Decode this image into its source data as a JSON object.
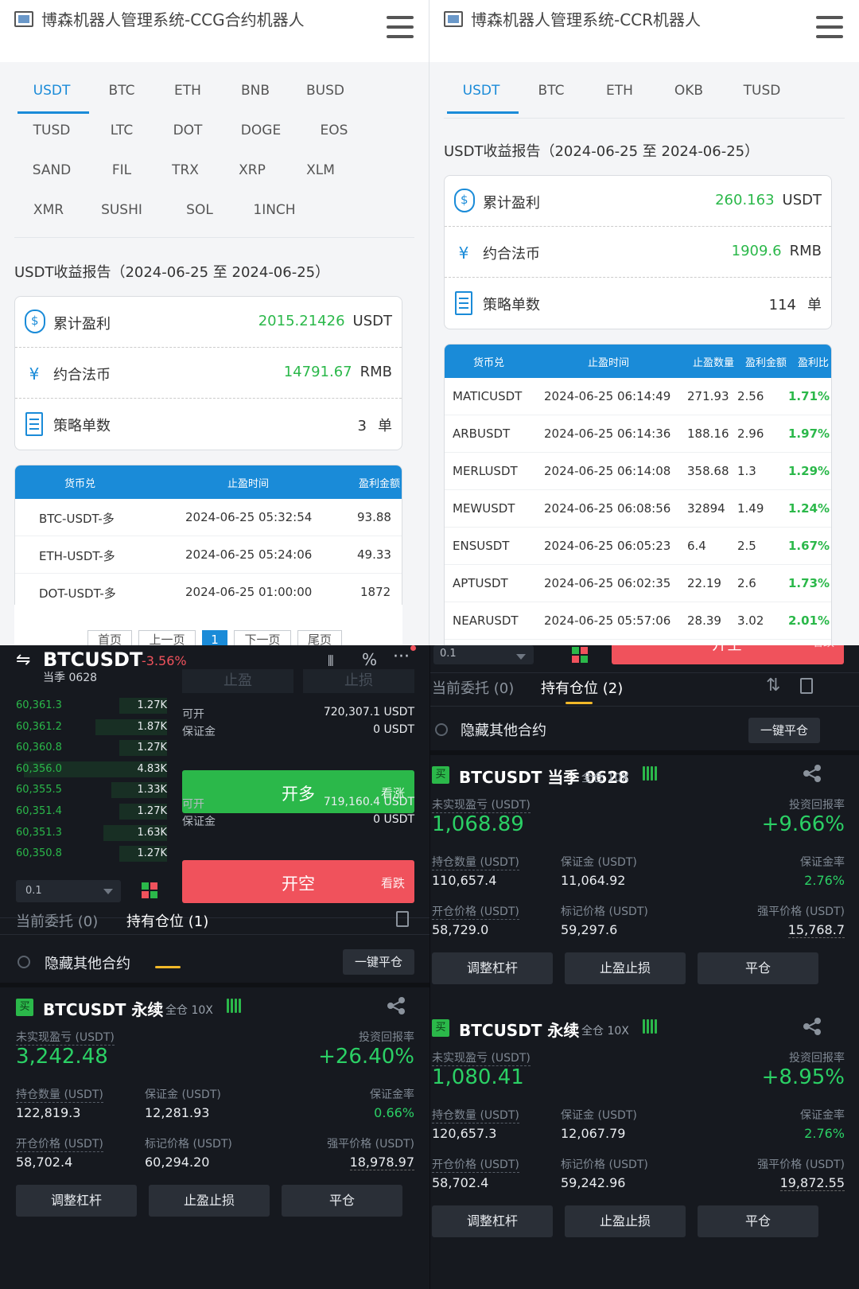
{
  "left_panel": {
    "title": "博森机器人管理系统-CCG合约机器人",
    "tabs": [
      "USDT",
      "BTC",
      "ETH",
      "BNB",
      "BUSD",
      "TUSD",
      "LTC",
      "DOT",
      "DOGE",
      "EOS",
      "SAND",
      "FIL",
      "TRX",
      "XRP",
      "XLM",
      "XMR",
      "SUSHI",
      "SOL",
      "1INCH"
    ],
    "active_tab": "USDT",
    "report_title": "USDT收益报告（2024-06-25 至 2024-06-25）",
    "summary": {
      "profit_label": "累计盈利",
      "profit_value": "2015.21426",
      "profit_unit": "USDT",
      "fiat_label": "约合法币",
      "fiat_value": "14791.67",
      "fiat_unit": "RMB",
      "orders_label": "策略单数",
      "orders_value": "3",
      "orders_unit": "单"
    },
    "table": {
      "headers": [
        "货币兑",
        "止盈时间",
        "盈利金额"
      ],
      "rows": [
        [
          "BTC-USDT-多",
          "2024-06-25 05:32:54",
          "93.88"
        ],
        [
          "ETH-USDT-多",
          "2024-06-25 05:24:06",
          "49.33"
        ],
        [
          "DOT-USDT-多",
          "2024-06-25 01:00:00",
          "1872"
        ]
      ]
    },
    "pager": [
      "首页",
      "上一页",
      "1",
      "下一页",
      "尾页"
    ]
  },
  "right_panel": {
    "title": "博森机器人管理系统-CCR机器人",
    "tabs": [
      "USDT",
      "BTC",
      "ETH",
      "OKB",
      "TUSD"
    ],
    "active_tab": "USDT",
    "report_title": "USDT收益报告（2024-06-25 至 2024-06-25）",
    "summary": {
      "profit_label": "累计盈利",
      "profit_value": "260.163",
      "profit_unit": "USDT",
      "fiat_label": "约合法币",
      "fiat_value": "1909.6",
      "fiat_unit": "RMB",
      "orders_label": "策略单数",
      "orders_value": "114",
      "orders_unit": "单"
    },
    "table": {
      "headers": [
        "货币兑",
        "止盈时间",
        "止盈数量",
        "盈利金额",
        "盈利比"
      ],
      "rows": [
        [
          "MATICUSDT",
          "2024-06-25 06:14:49",
          "271.93",
          "2.56",
          "1.71%"
        ],
        [
          "ARBUSDT",
          "2024-06-25 06:14:36",
          "188.16",
          "2.96",
          "1.97%"
        ],
        [
          "MERLUSDT",
          "2024-06-25 06:14:08",
          "358.68",
          "1.3",
          "1.29%"
        ],
        [
          "MEWUSDT",
          "2024-06-25 06:08:56",
          "32894",
          "1.49",
          "1.24%"
        ],
        [
          "ENSUSDT",
          "2024-06-25 06:05:23",
          "6.4",
          "2.5",
          "1.67%"
        ],
        [
          "APTUSDT",
          "2024-06-25 06:02:35",
          "22.19",
          "2.6",
          "1.73%"
        ],
        [
          "NEARUSDT",
          "2024-06-25 05:57:06",
          "28.39",
          "3.02",
          "2.01%"
        ]
      ]
    }
  },
  "trade_left": {
    "pair": "BTCUSDT",
    "change": "-3.56%",
    "sub": "当季 0628",
    "tp_label": "止盈",
    "sl_label": "止损",
    "orderbook": [
      [
        "60,361.3",
        "1.27K"
      ],
      [
        "60,361.2",
        "1.87K"
      ],
      [
        "60,360.8",
        "1.27K"
      ],
      [
        "60,356.0",
        "4.83K"
      ],
      [
        "60,355.5",
        "1.33K"
      ],
      [
        "60,351.4",
        "1.27K"
      ],
      [
        "60,351.3",
        "1.63K"
      ],
      [
        "60,350.8",
        "1.27K"
      ]
    ],
    "long_available_label": "可开",
    "long_available": "720,307.1 USDT",
    "long_margin_label": "保证金",
    "long_margin": "0 USDT",
    "long_btn": "开多",
    "long_hint": "看涨",
    "short_available_label": "可开",
    "short_available": "719,160.4 USDT",
    "short_margin_label": "保证金",
    "short_margin": "0 USDT",
    "short_btn": "开空",
    "short_hint": "看跌",
    "step": "0.1",
    "tab_orders": "当前委托 (0)",
    "tab_positions": "持有仓位 (1)",
    "hide_label": "隐藏其他合约",
    "close_all": "一键平仓",
    "positions": [
      {
        "side": "买",
        "name": "BTCUSDT 永续",
        "mode": "全仓 10X",
        "pnl_label": "未实现盈亏 (USDT)",
        "pnl": "3,242.48",
        "roi_label": "投资回报率",
        "roi": "+26.40%",
        "qty_label": "持仓数量 (USDT)",
        "qty": "122,819.3",
        "margin_label": "保证金 (USDT)",
        "margin": "12,281.93",
        "rate_label": "保证金率",
        "rate": "0.66%",
        "open_label": "开仓价格 (USDT)",
        "open": "58,702.4",
        "mark_label": "标记价格 (USDT)",
        "mark": "60,294.20",
        "liq_label": "强平价格 (USDT)",
        "liq": "18,978.97"
      }
    ],
    "actions": [
      "调整杠杆",
      "止盈止损",
      "平仓"
    ]
  },
  "trade_right": {
    "step": "0.1",
    "open_btn": "开空",
    "open_hint": "看跌",
    "tab_orders": "当前委托 (0)",
    "tab_positions": "持有仓位 (2)",
    "hide_label": "隐藏其他合约",
    "close_all": "一键平仓",
    "positions": [
      {
        "side": "买",
        "name": "BTCUSDT 当季 0628",
        "mode": "全仓 10X",
        "pnl_label": "未实现盈亏 (USDT)",
        "pnl": "1,068.89",
        "roi_label": "投资回报率",
        "roi": "+9.66%",
        "qty_label": "持仓数量 (USDT)",
        "qty": "110,657.4",
        "margin_label": "保证金 (USDT)",
        "margin": "11,064.92",
        "rate_label": "保证金率",
        "rate": "2.76%",
        "open_label": "开仓价格 (USDT)",
        "open": "58,729.0",
        "mark_label": "标记价格 (USDT)",
        "mark": "59,297.6",
        "liq_label": "强平价格 (USDT)",
        "liq": "15,768.7"
      },
      {
        "side": "买",
        "name": "BTCUSDT 永续",
        "mode": "全仓 10X",
        "pnl_label": "未实现盈亏 (USDT)",
        "pnl": "1,080.41",
        "roi_label": "投资回报率",
        "roi": "+8.95%",
        "qty_label": "持仓数量 (USDT)",
        "qty": "120,657.3",
        "margin_label": "保证金 (USDT)",
        "margin": "12,067.79",
        "rate_label": "保证金率",
        "rate": "2.76%",
        "open_label": "开仓价格 (USDT)",
        "open": "58,702.4",
        "mark_label": "标记价格 (USDT)",
        "mark": "59,242.96",
        "liq_label": "强平价格 (USDT)",
        "liq": "19,872.55"
      }
    ],
    "actions": [
      "调整杠杆",
      "止盈止损",
      "平仓"
    ]
  },
  "colors": {
    "accent": "#1a8bd8",
    "profit": "#2bb84a",
    "loss": "#f0525c",
    "dark_bg": "#16191f"
  }
}
